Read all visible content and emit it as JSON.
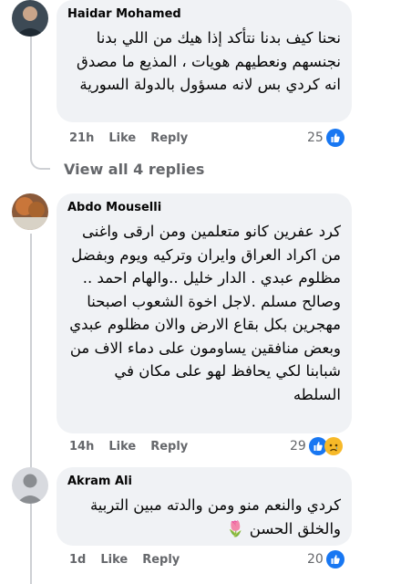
{
  "comments": [
    {
      "author": "Haidar Mohamed",
      "text": "نحنا كيف بدنا نتأكد إذا هيك من اللي بدنا نجنسهم ونعطيهم هويات ، المذيع ما مصدق انه كردي بس لانه مسؤول بالدولة السورية",
      "time": "21h",
      "like_label": "Like",
      "reply_label": "Reply",
      "reaction_count": "25",
      "reactions": [
        "like-icon"
      ]
    },
    {
      "author": "Abdo Mouselli",
      "text": "كرد عفرين كانو متعلمين ومن ارقى واغنى من اكراد العراق وايران وتركيه ويوم وبفضل مظلوم عبدي . الدار خليل ..والهام احمد .. وصالح مسلم .لاجل اخوة الشعوب اصبحنا مهجرين بكل بقاع الارض والان مظلوم عبدي وبعض منافقين يساومون على دماء الاف من شبابنا لكي يحافظ لهو على مكان في السلطه",
      "time": "14h",
      "like_label": "Like",
      "reply_label": "Reply",
      "reaction_count": "29",
      "reactions": [
        "like-icon",
        "sad-icon"
      ]
    },
    {
      "author": "Akram Ali",
      "text": "كردي والنعم منو ومن والدته مبين التربية والخلق الحسن 🌷",
      "time": "1d",
      "like_label": "Like",
      "reply_label": "Reply",
      "reaction_count": "20",
      "reactions": [
        "like-icon"
      ]
    }
  ],
  "view_replies_label": "View all 4 replies",
  "colors": {
    "bubble": "#f0f2f5",
    "meta": "#65676b",
    "like_blue": "#1877f2",
    "sad_yellow": "#f7b928"
  }
}
